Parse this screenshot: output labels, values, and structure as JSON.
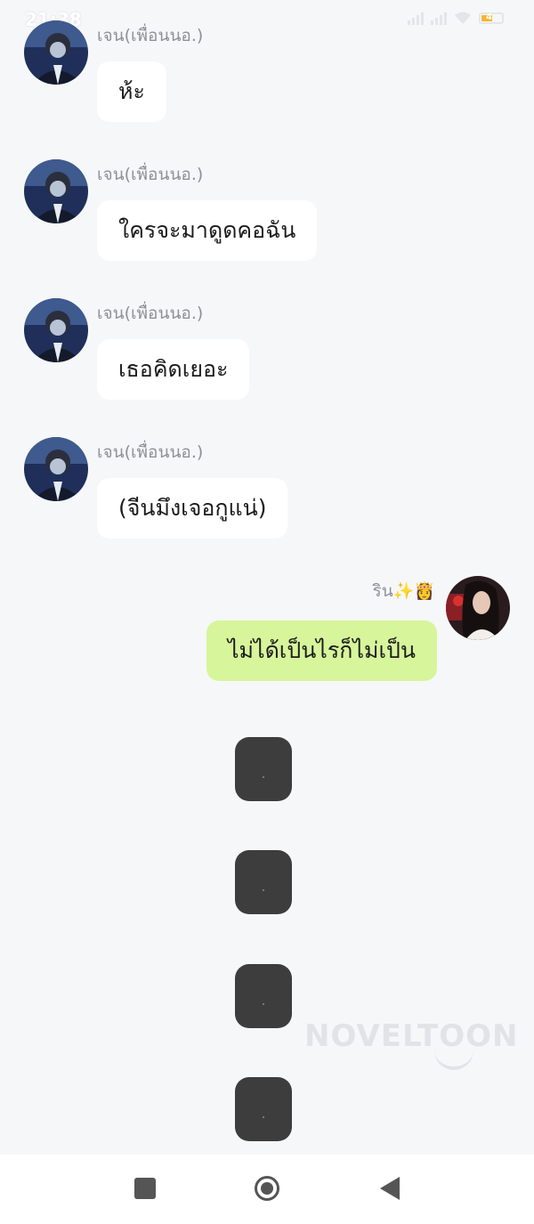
{
  "status_bar": {
    "time": "21:38",
    "battery": "4"
  },
  "chat": {
    "incoming": [
      {
        "sender": "เจน(เพื่อนนอ.)",
        "text": "ห้ะ"
      },
      {
        "sender": "เจน(เพื่อนนอ.)",
        "text": "ใครจะมาดูดคอฉัน"
      },
      {
        "sender": "เจน(เพื่อนนอ.)",
        "text": "เธอคิดเยอะ"
      },
      {
        "sender": "เจน(เพื่อนนอ.)",
        "text": "(จีนมึงเจอกูแน่)"
      }
    ],
    "outgoing": [
      {
        "sender": "ริน✨👸",
        "text": "ไม่ได้เป็นไรก็ไม่เป็น"
      }
    ],
    "typing_blocks": 4
  },
  "watermark": "NOVELTOON",
  "colors": {
    "background": "#f6f7f9",
    "incoming_bubble": "#ffffff",
    "outgoing_bubble": "#d7f59a",
    "block": "#3d3d3d"
  }
}
